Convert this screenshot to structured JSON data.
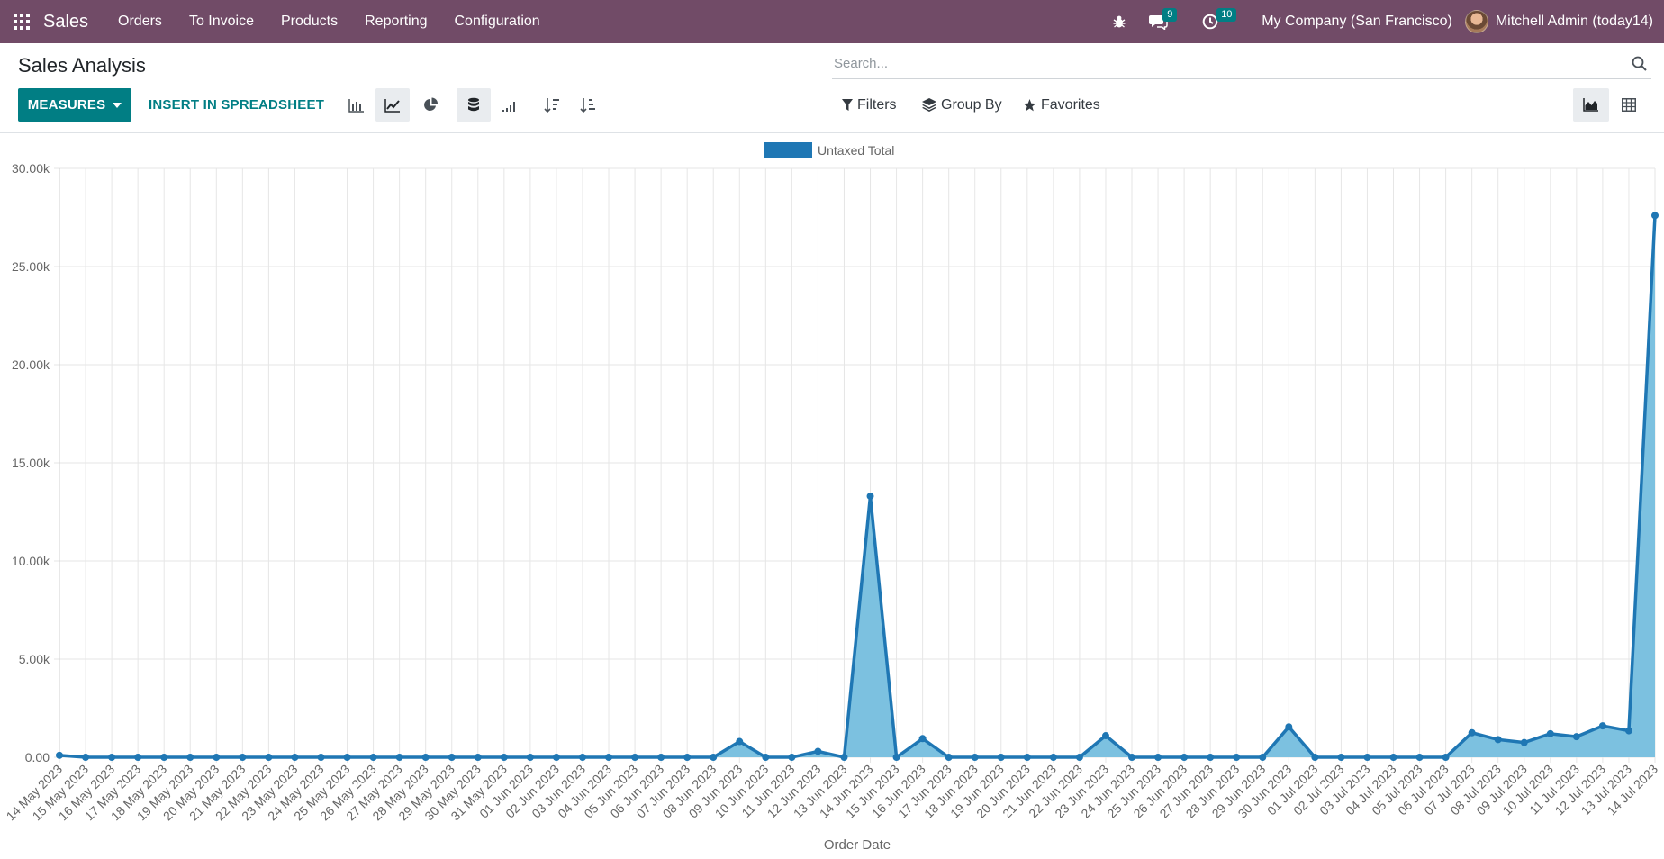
{
  "navbar": {
    "app_name": "Sales",
    "menu": [
      "Orders",
      "To Invoice",
      "Products",
      "Reporting",
      "Configuration"
    ],
    "messages_count": "9",
    "activities_count": "10",
    "company": "My Company (San Francisco)",
    "user": "Mitchell Admin (today14)",
    "color": "#714b67"
  },
  "page": {
    "title": "Sales Analysis"
  },
  "search": {
    "placeholder": "Search..."
  },
  "toolbar": {
    "measures_label": "MEASURES",
    "insert_label": "INSERT IN SPREADSHEET",
    "accent_color": "#017e84"
  },
  "filters": {
    "filters_label": "Filters",
    "groupby_label": "Group By",
    "favorites_label": "Favorites"
  },
  "chart_data": {
    "type": "area",
    "xlabel": "Order Date",
    "ylabel": "",
    "ylim": [
      0,
      30000
    ],
    "yticks": [
      "0.00",
      "5.00k",
      "10.00k",
      "15.00k",
      "20.00k",
      "25.00k",
      "30.00k"
    ],
    "legend_position": "top-center",
    "grid": true,
    "line_color": "#1f77b4",
    "fill_color": "#7cc1e0",
    "categories": [
      "14 May 2023",
      "15 May 2023",
      "16 May 2023",
      "17 May 2023",
      "18 May 2023",
      "19 May 2023",
      "20 May 2023",
      "21 May 2023",
      "22 May 2023",
      "23 May 2023",
      "24 May 2023",
      "25 May 2023",
      "26 May 2023",
      "27 May 2023",
      "28 May 2023",
      "29 May 2023",
      "30 May 2023",
      "31 May 2023",
      "01 Jun 2023",
      "02 Jun 2023",
      "03 Jun 2023",
      "04 Jun 2023",
      "05 Jun 2023",
      "06 Jun 2023",
      "07 Jun 2023",
      "08 Jun 2023",
      "09 Jun 2023",
      "10 Jun 2023",
      "11 Jun 2023",
      "12 Jun 2023",
      "13 Jun 2023",
      "14 Jun 2023",
      "15 Jun 2023",
      "16 Jun 2023",
      "17 Jun 2023",
      "18 Jun 2023",
      "19 Jun 2023",
      "20 Jun 2023",
      "21 Jun 2023",
      "22 Jun 2023",
      "23 Jun 2023",
      "24 Jun 2023",
      "25 Jun 2023",
      "26 Jun 2023",
      "27 Jun 2023",
      "28 Jun 2023",
      "29 Jun 2023",
      "30 Jun 2023",
      "01 Jul 2023",
      "02 Jul 2023",
      "03 Jul 2023",
      "04 Jul 2023",
      "05 Jul 2023",
      "06 Jul 2023",
      "07 Jul 2023",
      "08 Jul 2023",
      "09 Jul 2023",
      "10 Jul 2023",
      "11 Jul 2023",
      "12 Jul 2023",
      "13 Jul 2023",
      "14 Jul 2023"
    ],
    "series": [
      {
        "name": "Untaxed Total",
        "values": [
          100,
          0,
          0,
          0,
          0,
          0,
          0,
          0,
          0,
          0,
          0,
          0,
          0,
          0,
          0,
          0,
          0,
          0,
          0,
          0,
          0,
          0,
          0,
          0,
          0,
          0,
          800,
          0,
          0,
          300,
          0,
          13300,
          0,
          950,
          0,
          0,
          0,
          0,
          0,
          0,
          1100,
          0,
          0,
          0,
          0,
          0,
          0,
          1550,
          0,
          0,
          0,
          0,
          0,
          0,
          1250,
          900,
          750,
          1200,
          1050,
          1600,
          1350,
          27600
        ]
      }
    ]
  }
}
